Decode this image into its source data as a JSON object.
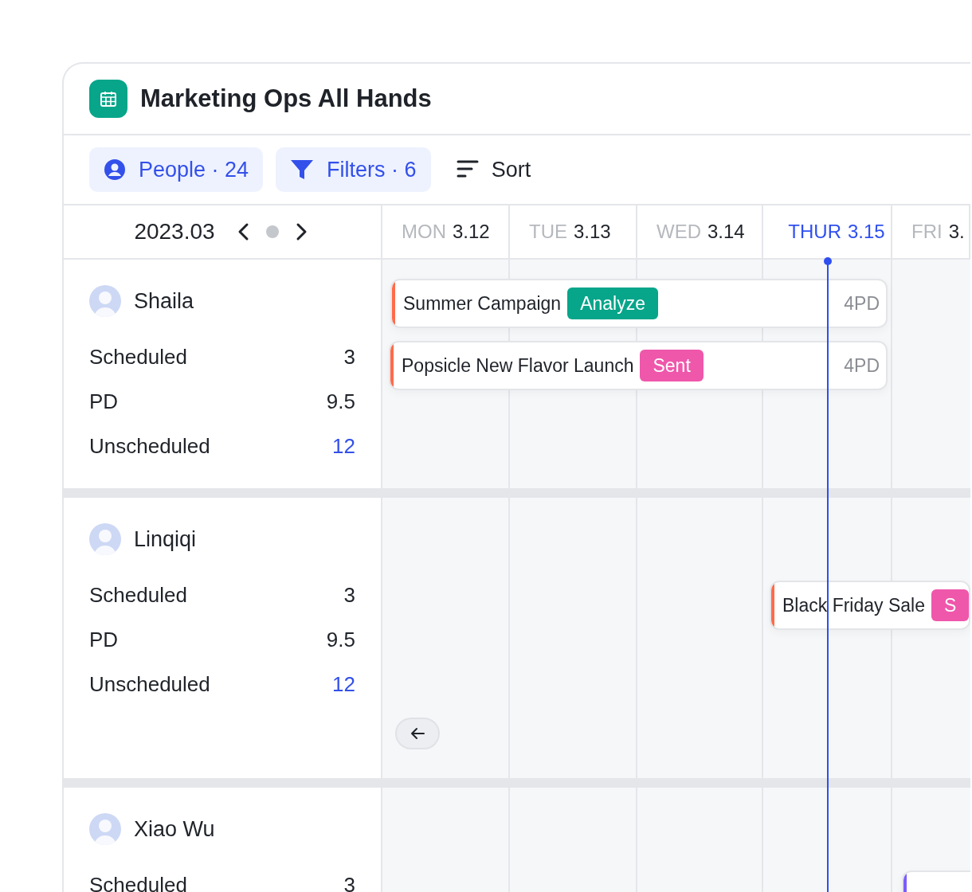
{
  "window": {
    "title": "Marketing Ops All Hands"
  },
  "toolbar": {
    "buttons": [
      {
        "kind": "people",
        "label": "People · 24"
      },
      {
        "kind": "filter",
        "label": "Filters · 6"
      },
      {
        "kind": "sort",
        "label": "Sort"
      }
    ]
  },
  "calendar_header": {
    "month": "2023.03",
    "days": [
      {
        "weekday": "MON",
        "date": "3.12",
        "today": false
      },
      {
        "weekday": "TUE",
        "date": "3.13",
        "today": false
      },
      {
        "weekday": "WED",
        "date": "3.14",
        "today": false
      },
      {
        "weekday": "THUR",
        "date": "3.15",
        "today": true
      },
      {
        "weekday": "FRI",
        "date": "3.",
        "today": false
      }
    ]
  },
  "people": [
    {
      "name": "Shaila",
      "stats": [
        {
          "label": "Scheduled",
          "value": "3",
          "kind": "plain"
        },
        {
          "label": "PD",
          "value": "9.5",
          "kind": "plain"
        },
        {
          "label": "Unscheduled",
          "value": "12",
          "kind": "link"
        }
      ],
      "events": [
        {
          "title": "Summer Campaign",
          "color": "#ff6b4a",
          "tag": {
            "label": "Analyze",
            "color": "#07a58a"
          },
          "duration": "4PD"
        },
        {
          "title": "Popsicle New Flavor Launch",
          "color": "#ff6b4a",
          "tag": {
            "label": "Sent",
            "color": "#ef57ab"
          },
          "duration": "4PD"
        }
      ]
    },
    {
      "name": "Linqiqi",
      "stats": [
        {
          "label": "Scheduled",
          "value": "3",
          "kind": "plain"
        },
        {
          "label": "PD",
          "value": "9.5",
          "kind": "plain"
        },
        {
          "label": "Unscheduled",
          "value": "12",
          "kind": "link"
        }
      ],
      "events": [
        {
          "title": "Black Friday Sale",
          "color": "#ff6b4a",
          "tag": {
            "label": "S",
            "color": "#ef57ab"
          }
        }
      ]
    },
    {
      "name": "Xiao Wu",
      "stats": [
        {
          "label": "Scheduled",
          "value": "3",
          "kind": "plain"
        }
      ],
      "events": [
        {
          "color": "#7b5cff"
        }
      ]
    }
  ]
}
